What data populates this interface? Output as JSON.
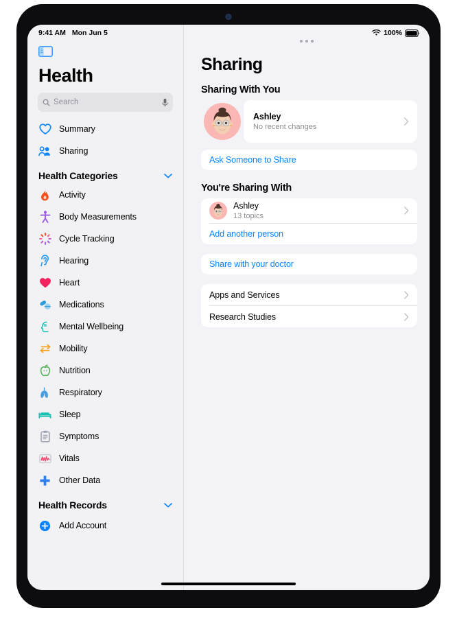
{
  "status_bar": {
    "time": "9:41 AM",
    "date": "Mon Jun 5",
    "battery_percent": "100%",
    "wifi_icon": "wifi-icon",
    "battery_icon": "battery-full-icon"
  },
  "sidebar": {
    "toggle_icon": "sidebar-toggle-icon",
    "app_title": "Health",
    "search": {
      "placeholder": "Search",
      "search_icon": "search-icon",
      "mic_icon": "microphone-icon"
    },
    "primary_items": [
      {
        "label": "Summary",
        "icon": "heart-outline-icon",
        "color": "#0a84ff"
      },
      {
        "label": "Sharing",
        "icon": "people-icon",
        "color": "#0a84ff"
      }
    ],
    "categories_header": {
      "label": "Health Categories",
      "chevron": "chevron-down-icon"
    },
    "categories": [
      {
        "label": "Activity",
        "icon": "flame-icon",
        "color": "#f4511e"
      },
      {
        "label": "Body Measurements",
        "icon": "body-figure-icon",
        "color": "#9b5de5"
      },
      {
        "label": "Cycle Tracking",
        "icon": "cycle-burst-icon",
        "color": "#f06292"
      },
      {
        "label": "Hearing",
        "icon": "ear-icon",
        "color": "#2196f3"
      },
      {
        "label": "Heart",
        "icon": "heart-filled-icon",
        "color": "#f4245e"
      },
      {
        "label": "Medications",
        "icon": "pills-icon",
        "color": "#2f9bd8"
      },
      {
        "label": "Mental Wellbeing",
        "icon": "head-brain-icon",
        "color": "#19bfb0"
      },
      {
        "label": "Mobility",
        "icon": "mobility-arrows-icon",
        "color": "#f5a623"
      },
      {
        "label": "Nutrition",
        "icon": "apple-icon",
        "color": "#4caf50"
      },
      {
        "label": "Respiratory",
        "icon": "lungs-icon",
        "color": "#4a9fe0"
      },
      {
        "label": "Sleep",
        "icon": "bed-icon",
        "color": "#19bfb0"
      },
      {
        "label": "Symptoms",
        "icon": "clipboard-icon",
        "color": "#9aa0b0"
      },
      {
        "label": "Vitals",
        "icon": "waveform-icon",
        "color": "#f4486b"
      },
      {
        "label": "Other Data",
        "icon": "plus-cross-icon",
        "color": "#2f80ed"
      }
    ],
    "records_header": {
      "label": "Health Records",
      "chevron": "chevron-down-icon"
    },
    "add_account": {
      "label": "Add Account",
      "icon": "plus-circle-icon",
      "color": "#0a84ff"
    }
  },
  "main": {
    "page_title": "Sharing",
    "grabber_icon": "window-grabber-icon",
    "sharing_with_you": {
      "section_title": "Sharing With You",
      "person": {
        "name": "Ashley",
        "subtitle": "No recent changes",
        "avatar": "memoji-avatar",
        "chevron": "chevron-right-icon"
      },
      "ask_link": "Ask Someone to Share"
    },
    "youre_sharing_with": {
      "section_title": "You're Sharing With",
      "person": {
        "name": "Ashley",
        "subtitle": "13 topics",
        "avatar": "memoji-avatar",
        "chevron": "chevron-right-icon"
      },
      "add_link": "Add another person"
    },
    "doctor_link": "Share with your doctor",
    "more_rows": [
      {
        "label": "Apps and Services",
        "chevron": "chevron-right-icon"
      },
      {
        "label": "Research Studies",
        "chevron": "chevron-right-icon"
      }
    ]
  },
  "colors": {
    "accent_blue": "#0a84ff",
    "background": "#f2f2f7",
    "card": "#ffffff",
    "secondary_text": "#8e8e93"
  }
}
